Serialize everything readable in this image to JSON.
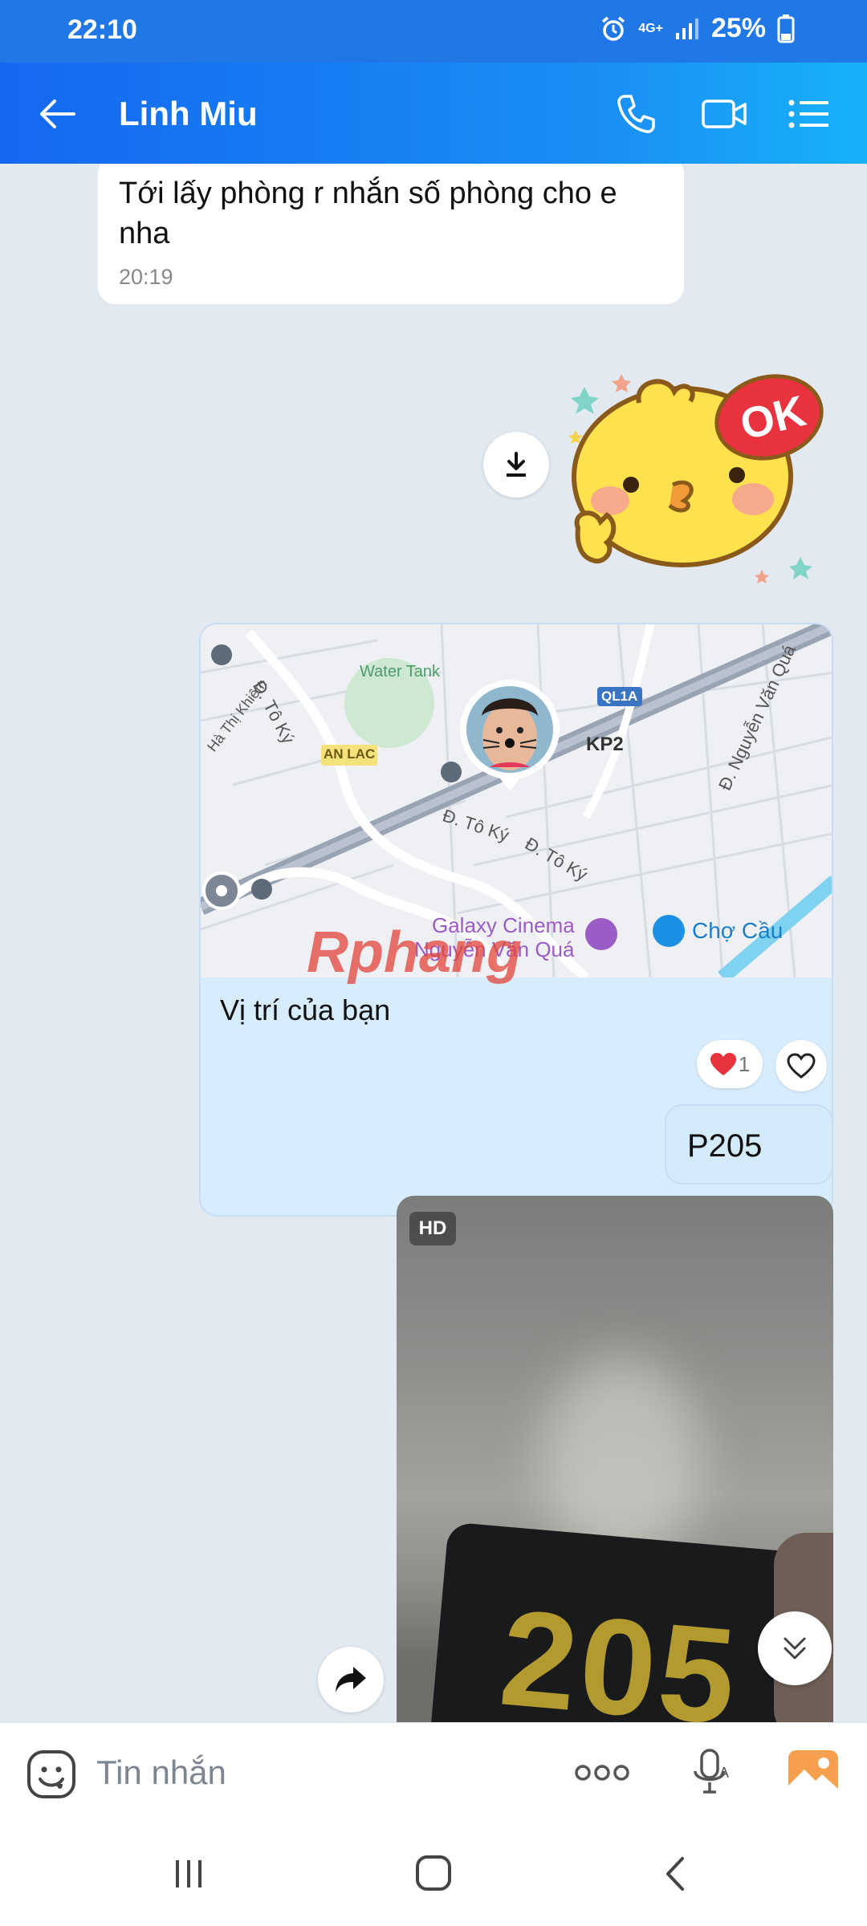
{
  "status_bar": {
    "time": "22:10",
    "network": "4G+",
    "battery": "25%"
  },
  "header": {
    "contact_name": "Linh Miu"
  },
  "messages": {
    "incoming_text": "Tới lấy phòng r nhắn số phòng cho e nha",
    "incoming_time": "20:19",
    "map_caption": "Vị trí của bạn",
    "map_labels": {
      "water_tank": "Water Tank",
      "an_lac": "AN LAC",
      "ql1a": "QL1A",
      "kp2": "KP2",
      "to_ky_1": "Đ. Tô Ký",
      "to_ky_2": "Đ. Tô Ký",
      "to_ky_3": "Đ. Tô Ký",
      "ha_thi_khiem": "Hà Thị Khiêm",
      "nguyen_van_qua": "Đ. Nguyễn Văn Quá",
      "galaxy_1": "Galaxy Cinema",
      "galaxy_2": "Nguyễn Văn Quá",
      "cho_cau": "Chợ Cầu",
      "watermark": "Rphang"
    },
    "reaction_count": "1",
    "outgoing_text": "P205",
    "photo_badge": "HD",
    "photo_number": "205"
  },
  "sticker_text": "OK",
  "input": {
    "placeholder": "Tin nhắn"
  },
  "colors": {
    "header_start": "#1468f0",
    "header_end": "#17b2f8",
    "outgoing_bubble": "#d4ebfc",
    "chat_bg": "#e2e9f1"
  }
}
